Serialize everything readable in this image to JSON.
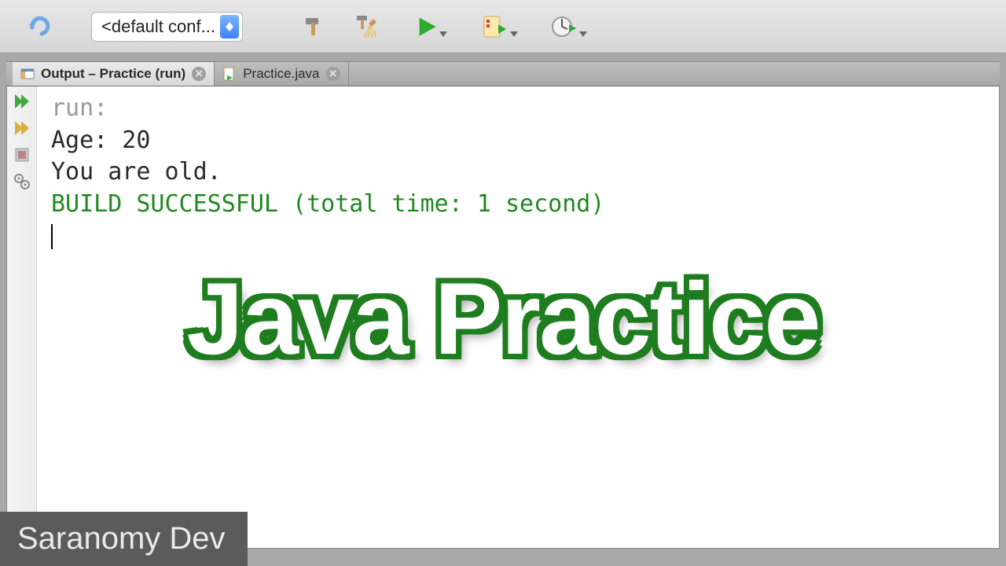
{
  "toolbar": {
    "config_label": "<default conf...",
    "icons": {
      "redo": "redo-icon",
      "build": "hammer-icon",
      "clean": "clean-build-icon",
      "run": "run-icon",
      "debug": "debug-icon",
      "profile": "profile-icon"
    }
  },
  "tabs": [
    {
      "label": "Output – Practice (run)",
      "active": true,
      "icon": "output-panel-icon"
    },
    {
      "label": "Practice.java",
      "active": false,
      "icon": "java-file-icon"
    }
  ],
  "gutter": {
    "icons": [
      "rerun-icon",
      "rerun-fast-icon",
      "stop-icon",
      "settings-icon"
    ]
  },
  "console": {
    "lines": [
      {
        "text": "run:",
        "kind": "run"
      },
      {
        "text": "Age: 20",
        "kind": "out"
      },
      {
        "text": "You are old.",
        "kind": "out"
      },
      {
        "text": "BUILD SUCCESSFUL (total time: 1 second)",
        "kind": "success"
      }
    ]
  },
  "overlay": {
    "title": "Java Practice",
    "channel": "Saranomy Dev"
  },
  "colors": {
    "success": "#1f8a1f",
    "muted": "#9a9a9a",
    "overlay_stroke": "#1e7d1e",
    "watermark_bg": "#5b5b5b"
  }
}
